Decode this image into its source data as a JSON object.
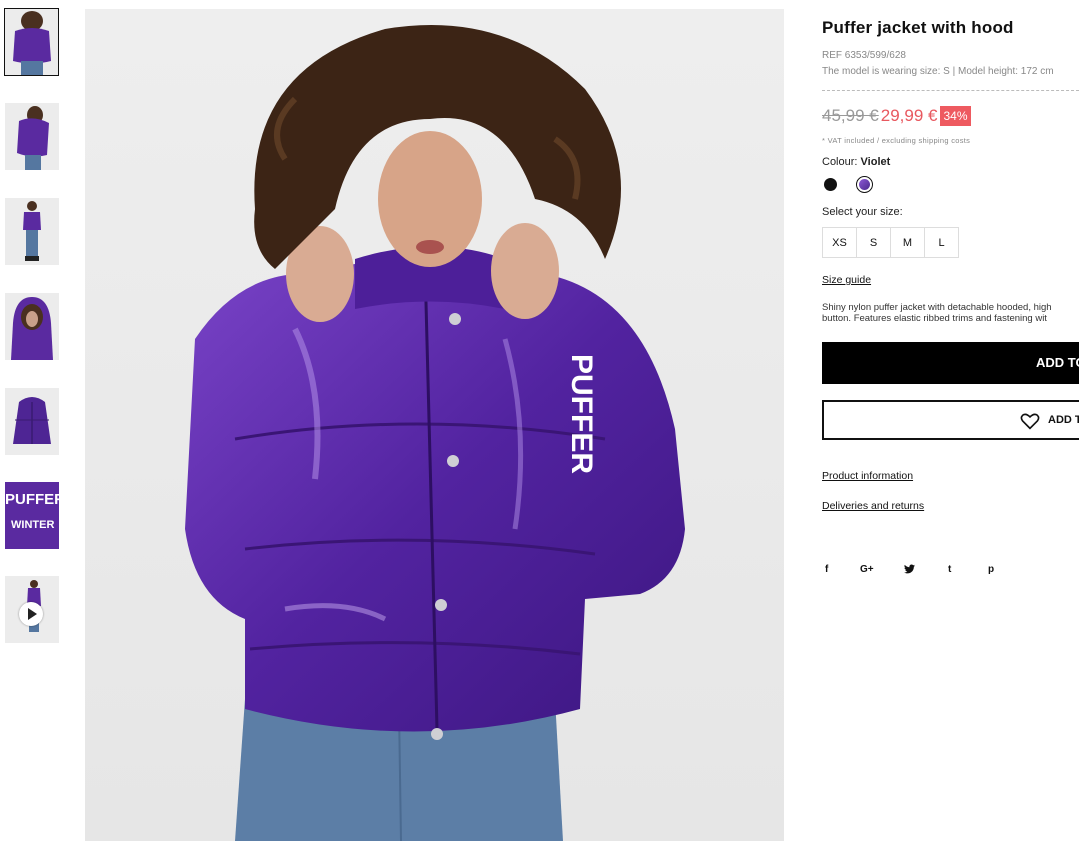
{
  "gallery": {
    "thumbnails": [
      {
        "label": "view-front",
        "active": true
      },
      {
        "label": "view-side-back"
      },
      {
        "label": "view-full-body"
      },
      {
        "label": "view-hood-up"
      },
      {
        "label": "view-flat"
      },
      {
        "label": "view-detail-print"
      },
      {
        "label": "view-video",
        "has_video": true
      }
    ],
    "print_text_1": "PUFFER",
    "print_text_2": "WINTER"
  },
  "product": {
    "title": "Puffer jacket with hood",
    "ref": "REF 6353/599/628",
    "model_info": "The model is wearing size: S | Model height: 172 cm",
    "old_price": "45,99 €",
    "new_price": "29,99 €",
    "discount": "34%",
    "vat_note": "* VAT included / excluding shipping costs",
    "colour_label": "Colour:",
    "colour_value": "Violet",
    "colours": [
      {
        "name": "black",
        "hex": "#111111"
      },
      {
        "name": "violet",
        "hex": "#6a3cb5",
        "selected": true
      }
    ],
    "size_label": "Select your size:",
    "sizes": [
      "XS",
      "S",
      "M",
      "L"
    ],
    "size_guide": "Size guide",
    "description_line1": "Shiny nylon puffer jacket with detachable hooded, high",
    "description_line2": "button. Features elastic ribbed trims and fastening wit",
    "add_to_bag": "ADD TO",
    "add_to_wishlist": "ADD T",
    "product_information": "Product information",
    "deliveries_returns": "Deliveries and returns",
    "social": [
      "f",
      "G+",
      "t",
      "t",
      "p"
    ]
  },
  "colors": {
    "accent_red": "#ee5a60",
    "jacket": "#5a2aa0",
    "black": "#000000"
  }
}
